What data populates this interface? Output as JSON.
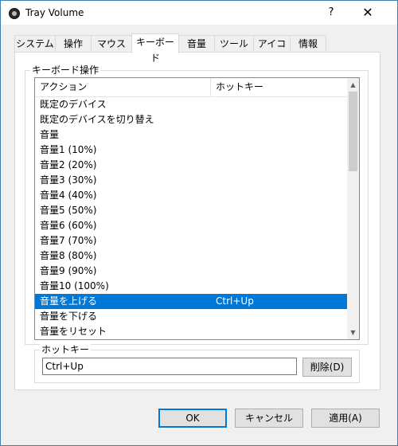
{
  "window": {
    "title": "Tray Volume"
  },
  "titlebar": {
    "help_glyph": "?",
    "close_glyph": "✕"
  },
  "tabs": [
    "システム",
    "操作",
    "マウス",
    "キーボード",
    "音量",
    "ツール",
    "アイコン",
    "情報"
  ],
  "active_tab": "キーボード",
  "keyboard_group": {
    "label": "キーボード操作"
  },
  "list": {
    "headers": {
      "action": "アクション",
      "hotkey": "ホットキー"
    },
    "rows": [
      {
        "action": "既定のデバイス",
        "hotkey": ""
      },
      {
        "action": "既定のデバイスを切り替え",
        "hotkey": ""
      },
      {
        "action": "音量",
        "hotkey": ""
      },
      {
        "action": "音量1 (10%)",
        "hotkey": ""
      },
      {
        "action": "音量2 (20%)",
        "hotkey": ""
      },
      {
        "action": "音量3 (30%)",
        "hotkey": ""
      },
      {
        "action": "音量4 (40%)",
        "hotkey": ""
      },
      {
        "action": "音量5 (50%)",
        "hotkey": ""
      },
      {
        "action": "音量6 (60%)",
        "hotkey": ""
      },
      {
        "action": "音量7 (70%)",
        "hotkey": ""
      },
      {
        "action": "音量8 (80%)",
        "hotkey": ""
      },
      {
        "action": "音量9 (90%)",
        "hotkey": ""
      },
      {
        "action": "音量10 (100%)",
        "hotkey": ""
      },
      {
        "action": "音量を上げる",
        "hotkey": "Ctrl+Up"
      },
      {
        "action": "音量を下げる",
        "hotkey": ""
      },
      {
        "action": "音量をリセット",
        "hotkey": ""
      }
    ],
    "selected_index": 13
  },
  "hotkey_group": {
    "label": "ホットキー",
    "value": "Ctrl+Up",
    "delete_label": "削除(D)"
  },
  "footer": {
    "ok_label": "OK",
    "cancel_label": "キャンセル",
    "apply_label": "適用(A)"
  },
  "colors": {
    "selection": "#0078d7",
    "default_button_border": "#0078d7"
  }
}
